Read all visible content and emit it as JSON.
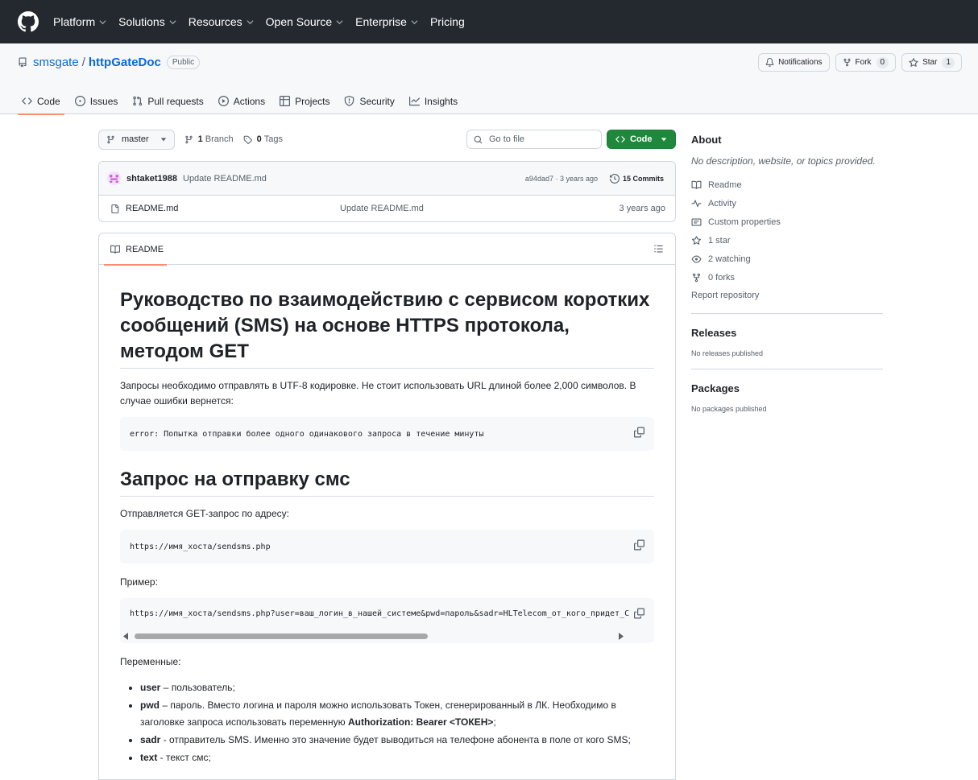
{
  "topnav": {
    "items": [
      "Platform",
      "Solutions",
      "Resources",
      "Open Source",
      "Enterprise",
      "Pricing"
    ]
  },
  "repo": {
    "owner": "smsgate",
    "separator": "/",
    "name": "httpGateDoc",
    "visibility": "Public",
    "notifications_label": "Notifications",
    "fork_label": "Fork",
    "fork_count": "0",
    "star_label": "Star",
    "star_count": "1"
  },
  "reponav": {
    "items": [
      "Code",
      "Issues",
      "Pull requests",
      "Actions",
      "Projects",
      "Security",
      "Insights"
    ],
    "active": "Code"
  },
  "toolbar": {
    "branch": "master",
    "branches_count": "1",
    "branches_label": "Branch",
    "tags_count": "0",
    "tags_label": "Tags",
    "goto_placeholder": "Go to file",
    "code_button": "Code"
  },
  "commit": {
    "author": "shtaket1988",
    "message": "Update README.md",
    "hash_age": "a94dad7 · 3 years ago",
    "commits_count": "15 Commits"
  },
  "files": [
    {
      "name": "README.md",
      "message": "Update README.md",
      "age": "3 years ago"
    }
  ],
  "readme": {
    "tab_label": "README",
    "h1_main": "Руководство по взаимодействию с сервисом коротких сообщений (SMS) на основе HTTPS протокола, методом GET",
    "p_intro": "Запросы необходимо отправлять в UTF-8 кодировке. Не стоит использовать URL длиной более 2,000 символов. В случае ошибки вернется:",
    "code_error": "error: Попытка отправки более одного одинакового запроса в течение минуты",
    "h1_send": "Запрос на отправку смс",
    "p_send": "Отправляется GET-запрос по адресу:",
    "code_url": "https://имя_хоста/sendsms.php",
    "p_example": "Пример:",
    "code_example": "https://имя_хоста/sendsms.php?user=ваш_логин_в_нашей_системе&pwd=пароль&sadr=HLTelecom_от_кого_придет_С",
    "p_vars": "Переменные:",
    "vars": [
      {
        "key": "user",
        "desc": " – пользователь;"
      },
      {
        "key": "pwd",
        "desc": " – пароль. Вместо логина и пароля можно использовать Токен, сгенерированный в ЛК. Необходимо в заголовке запроса использовать переменную ",
        "extra_bold": "Authorization: Bearer <ТОКЕН>",
        "tail": ";"
      },
      {
        "key": "sadr",
        "desc": " - отправитель SMS. Именно это значение будет выводиться на телефоне абонента в поле от кого SMS;"
      },
      {
        "key": "text",
        "desc": " - текст смс;"
      }
    ]
  },
  "sidebar": {
    "about_title": "About",
    "description": "No description, website, or topics provided.",
    "links": [
      "Readme",
      "Activity",
      "Custom properties",
      "1 star",
      "2 watching",
      "0 forks"
    ],
    "report": "Report repository",
    "releases_title": "Releases",
    "releases_text": "No releases published",
    "packages_title": "Packages",
    "packages_text": "No packages published"
  }
}
